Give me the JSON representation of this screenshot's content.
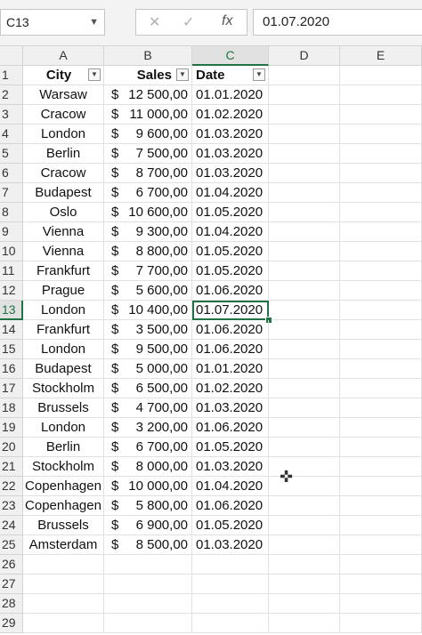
{
  "formula_bar": {
    "name_box": "C13",
    "cancel_glyph": "✕",
    "enter_glyph": "✓",
    "fx_glyph": "fx",
    "value": "01.07.2020"
  },
  "columns": [
    "A",
    "B",
    "C",
    "D",
    "E"
  ],
  "header_row": {
    "city": "City",
    "sales": "Sales",
    "date": "Date"
  },
  "rows": [
    {
      "n": "2",
      "city": "Warsaw",
      "cur": "$",
      "sales": "12 500,00",
      "date": "01.01.2020"
    },
    {
      "n": "3",
      "city": "Cracow",
      "cur": "$",
      "sales": "11 000,00",
      "date": "01.02.2020"
    },
    {
      "n": "4",
      "city": "London",
      "cur": "$",
      "sales": "9 600,00",
      "date": "01.03.2020"
    },
    {
      "n": "5",
      "city": "Berlin",
      "cur": "$",
      "sales": "7 500,00",
      "date": "01.03.2020"
    },
    {
      "n": "6",
      "city": "Cracow",
      "cur": "$",
      "sales": "8 700,00",
      "date": "01.03.2020"
    },
    {
      "n": "7",
      "city": "Budapest",
      "cur": "$",
      "sales": "6 700,00",
      "date": "01.04.2020"
    },
    {
      "n": "8",
      "city": "Oslo",
      "cur": "$",
      "sales": "10 600,00",
      "date": "01.05.2020"
    },
    {
      "n": "9",
      "city": "Vienna",
      "cur": "$",
      "sales": "9 300,00",
      "date": "01.04.2020"
    },
    {
      "n": "10",
      "city": "Vienna",
      "cur": "$",
      "sales": "8 800,00",
      "date": "01.05.2020"
    },
    {
      "n": "11",
      "city": "Frankfurt",
      "cur": "$",
      "sales": "7 700,00",
      "date": "01.05.2020"
    },
    {
      "n": "12",
      "city": "Prague",
      "cur": "$",
      "sales": "5 600,00",
      "date": "01.06.2020"
    },
    {
      "n": "13",
      "city": "London",
      "cur": "$",
      "sales": "10 400,00",
      "date": "01.07.2020"
    },
    {
      "n": "14",
      "city": "Frankfurt",
      "cur": "$",
      "sales": "3 500,00",
      "date": "01.06.2020"
    },
    {
      "n": "15",
      "city": "London",
      "cur": "$",
      "sales": "9 500,00",
      "date": "01.06.2020"
    },
    {
      "n": "16",
      "city": "Budapest",
      "cur": "$",
      "sales": "5 000,00",
      "date": "01.01.2020"
    },
    {
      "n": "17",
      "city": "Stockholm",
      "cur": "$",
      "sales": "6 500,00",
      "date": "01.02.2020"
    },
    {
      "n": "18",
      "city": "Brussels",
      "cur": "$",
      "sales": "4 700,00",
      "date": "01.03.2020"
    },
    {
      "n": "19",
      "city": "London",
      "cur": "$",
      "sales": "3 200,00",
      "date": "01.06.2020"
    },
    {
      "n": "20",
      "city": "Berlin",
      "cur": "$",
      "sales": "6 700,00",
      "date": "01.05.2020"
    },
    {
      "n": "21",
      "city": "Stockholm",
      "cur": "$",
      "sales": "8 000,00",
      "date": "01.03.2020"
    },
    {
      "n": "22",
      "city": "Copenhagen",
      "cur": "$",
      "sales": "10 000,00",
      "date": "01.04.2020"
    },
    {
      "n": "23",
      "city": "Copenhagen",
      "cur": "$",
      "sales": "5 800,00",
      "date": "01.06.2020"
    },
    {
      "n": "24",
      "city": "Brussels",
      "cur": "$",
      "sales": "6 900,00",
      "date": "01.05.2020"
    },
    {
      "n": "25",
      "city": "Amsterdam",
      "cur": "$",
      "sales": "8 500,00",
      "date": "01.03.2020"
    }
  ],
  "empty_rows": [
    "26",
    "27",
    "28",
    "29"
  ],
  "selected_row": "13",
  "accent_color": "#217346"
}
